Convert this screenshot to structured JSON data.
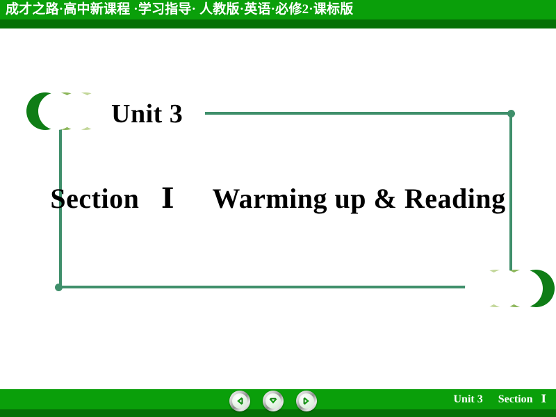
{
  "header": {
    "title": "成才之路·高中新课程 ·学习指导· 人教版·英语·必修2·课标版",
    "bg_color": "#0a9f0a",
    "strip_color": "#067006",
    "text_color": "#ffffff"
  },
  "slide": {
    "unit_label": "Unit 3",
    "section_label": "Section",
    "section_numeral": "Ⅰ",
    "section_topic": "Warming up & Reading",
    "frame_color": "#3f8f6b",
    "title_color": "#000000"
  },
  "decoration": {
    "crescents_left": [
      {
        "name": "crescent-dark",
        "color": "#0f7d16"
      },
      {
        "name": "crescent-medium",
        "color": "#8cb65a"
      },
      {
        "name": "crescent-light",
        "color": "#c3d79a"
      }
    ],
    "crescents_right": [
      {
        "name": "crescent-light",
        "color": "#c3d79a"
      },
      {
        "name": "crescent-medium",
        "color": "#8cb65a"
      },
      {
        "name": "crescent-dark",
        "color": "#0f7d16"
      }
    ]
  },
  "footer": {
    "unit_label": "Unit 3",
    "section_label": "Section",
    "section_numeral": "Ⅰ",
    "bg_color": "#0a9f0a",
    "strip_color": "#067006",
    "text_color": "#ffffff",
    "nav": [
      {
        "name": "previous-slide-button",
        "icon": "arrow-left-icon"
      },
      {
        "name": "down-slide-button",
        "icon": "arrow-down-icon"
      },
      {
        "name": "next-slide-button",
        "icon": "arrow-right-icon"
      }
    ],
    "nav_arrow_color": "#169c16"
  }
}
